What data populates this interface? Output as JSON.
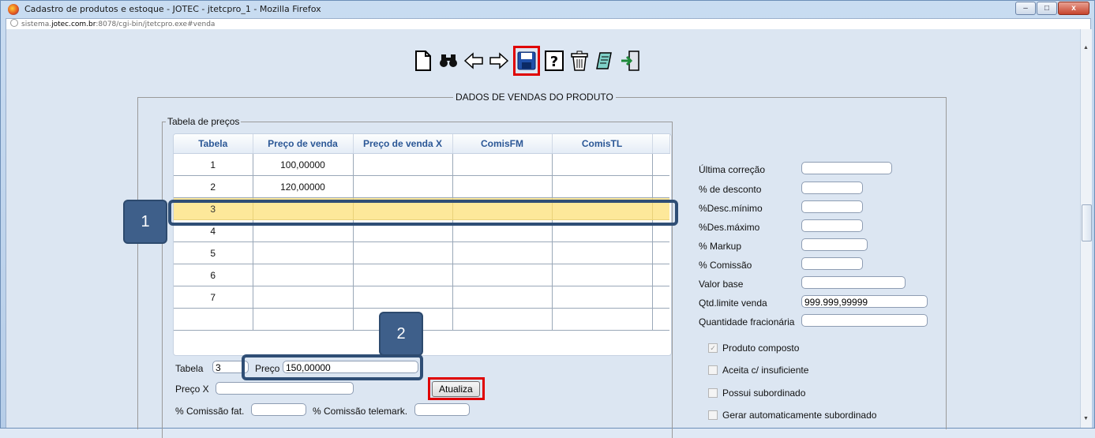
{
  "window": {
    "title": "Cadastro de produtos e estoque - JOTEC - jtetcpro_1 - Mozilla Firefox",
    "url_prefix": "sistema.",
    "url_host": "jotec.com.br",
    "url_rest": ":8078/cgi-bin/jtetcpro.exe#venda",
    "buttons": {
      "minimize": "–",
      "maximize": "□",
      "close": "x"
    }
  },
  "toolbar": {
    "icons": [
      "new-document-icon",
      "binoculars-search-icon",
      "arrow-left-icon",
      "arrow-right-icon",
      "save-disk-icon",
      "help-icon",
      "trash-icon",
      "notes-icon",
      "exit-door-icon"
    ],
    "highlighted": "save-disk-icon"
  },
  "section": {
    "title": "DADOS DE VENDAS DO PRODUTO"
  },
  "price_table": {
    "legend": "Tabela de preços",
    "columns": [
      "Tabela",
      "Preço de venda",
      "Preço de venda X",
      "ComisFM",
      "ComisTL"
    ],
    "rows": [
      [
        "1",
        "100,00000",
        "",
        "",
        ""
      ],
      [
        "2",
        "120,00000",
        "",
        "",
        ""
      ],
      [
        "3",
        "",
        "",
        "",
        ""
      ],
      [
        "4",
        "",
        "",
        "",
        ""
      ],
      [
        "5",
        "",
        "",
        "",
        ""
      ],
      [
        "6",
        "",
        "",
        "",
        ""
      ],
      [
        "7",
        "",
        "",
        "",
        ""
      ],
      [
        "",
        "",
        "",
        "",
        ""
      ]
    ],
    "selected_row": "3"
  },
  "edit_form": {
    "tabela_label": "Tabela",
    "tabela_value": "3",
    "preco_label": "Preço",
    "preco_value": "150,00000",
    "preco_x_label": "Preço X",
    "preco_x_value": "",
    "atualiza_label": "Atualiza",
    "comissao_fat_label": "% Comissão fat.",
    "comissao_fat_value": "",
    "comissao_telemark_label": "% Comissão telemark.",
    "comissao_telemark_value": ""
  },
  "right_fields": [
    {
      "label": "Última correção",
      "value": ""
    },
    {
      "label": "% de desconto",
      "value": ""
    },
    {
      "label": "%Desc.mínimo",
      "value": ""
    },
    {
      "label": "%Des.máximo",
      "value": ""
    },
    {
      "label": "% Markup",
      "value": ""
    },
    {
      "label": "% Comissão",
      "value": ""
    },
    {
      "label": "Valor base",
      "value": ""
    },
    {
      "label": "Qtd.limite venda",
      "value": "999.999,99999"
    },
    {
      "label": "Quantidade fracionária",
      "value": ""
    }
  ],
  "checkboxes": [
    {
      "label": "Produto composto",
      "checked": true,
      "disabled": true
    },
    {
      "label": "Aceita c/ insuficiente",
      "checked": false
    },
    {
      "label": "Possui subordinado",
      "checked": false
    },
    {
      "label": "Gerar automaticamente subordinado",
      "checked": false
    }
  ],
  "callouts": {
    "one": "1",
    "two": "2"
  },
  "colors": {
    "highlight_red": "#e00000",
    "selected_row": "#fde89a",
    "callout_blue": "#3e5f8a"
  }
}
